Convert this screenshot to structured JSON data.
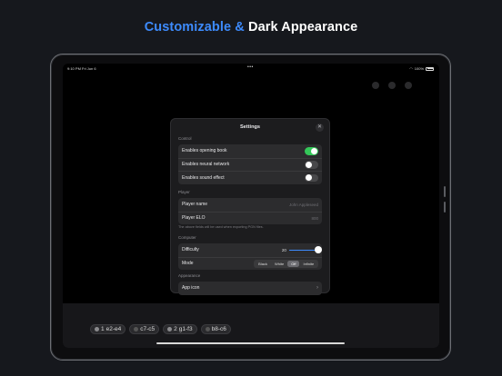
{
  "headline": {
    "accent": "Customizable &",
    "rest": "Dark Appearance"
  },
  "statusbar": {
    "time": "9:10 PM",
    "date": "Fri Jun 6",
    "battery": "100%"
  },
  "modal": {
    "title": "Settings",
    "close_icon": "close-icon",
    "control": {
      "heading": "Control",
      "rows": [
        {
          "label": "Enables opening book",
          "on": true
        },
        {
          "label": "Enables neural network",
          "on": false
        },
        {
          "label": "Enables sound effect",
          "on": false
        }
      ]
    },
    "player": {
      "heading": "Player",
      "name_label": "Player name",
      "name_placeholder": "John Appleseed",
      "elo_label": "Player ELO",
      "elo_placeholder": "800",
      "footnote": "The above fields will be used when exporting PGN files."
    },
    "computer": {
      "heading": "Computer",
      "difficulty_label": "Difficulty",
      "difficulty_value": "20",
      "difficulty_fraction": 1.0,
      "mode_label": "Mode",
      "mode_options": [
        "Black",
        "White",
        "Off",
        "Infinite"
      ],
      "mode_selected": "Off"
    },
    "appearance": {
      "heading": "Appearance",
      "app_icon_label": "App icon"
    }
  },
  "moves": [
    {
      "text": "e2-e4",
      "piece": "white",
      "number": "1"
    },
    {
      "text": "c7-c5",
      "piece": "black",
      "number": ""
    },
    {
      "text": "g1-f3",
      "piece": "white",
      "number": "2"
    },
    {
      "text": "b8-c6",
      "piece": "black",
      "number": ""
    }
  ]
}
